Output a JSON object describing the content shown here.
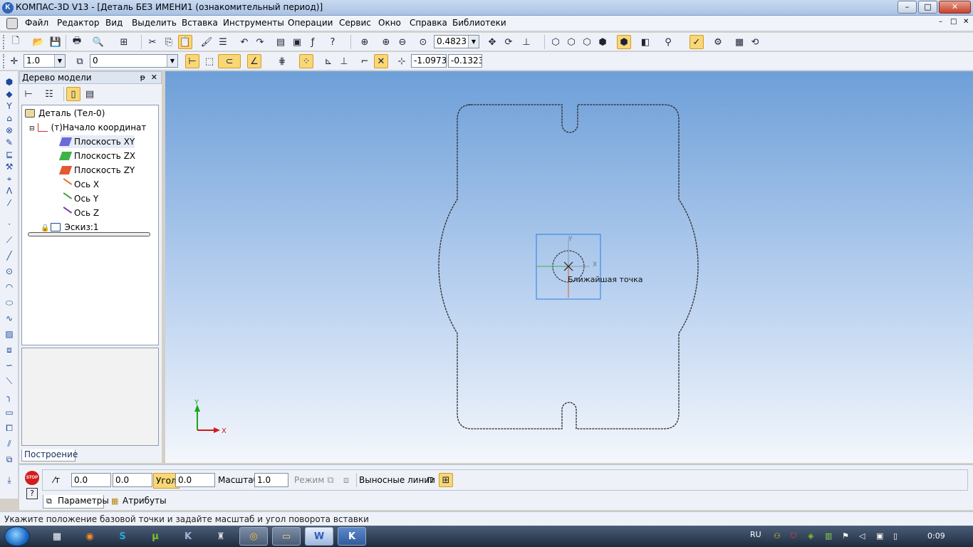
{
  "window": {
    "app_name": "КОМПАС-3D V13",
    "title_sep": " - ",
    "doc_title": "[Деталь БЕЗ ИМЕНИ1 (ознакомительный период)]",
    "min_label": "–",
    "max_label": "□",
    "close_label": "✕"
  },
  "menu": [
    "Файл",
    "Редактор",
    "Вид",
    "Выделить",
    "Вставка",
    "Инструменты",
    "Операции",
    "Сервис",
    "Окно",
    "Справка",
    "Библиотеки"
  ],
  "toolbar": {
    "zoom_value": "0.4823"
  },
  "toolbar2": {
    "line_scale": "1.0",
    "layer": "0",
    "coord_x": "-1.0973",
    "coord_y": "-0.1323"
  },
  "model_tree": {
    "header": "Дерево модели",
    "pin": "ᵽ",
    "close": "✕",
    "nodes": [
      {
        "label": "Деталь (Тел-0)",
        "icon": "part-icon"
      },
      {
        "label": "(т)Начало координат",
        "icon": "origin-icon"
      },
      {
        "label": "Плоскость XY",
        "icon": "plane-xy-icon"
      },
      {
        "label": "Плоскость ZX",
        "icon": "plane-zx-icon"
      },
      {
        "label": "Плоскость ZY",
        "icon": "plane-zy-icon"
      },
      {
        "label": "Ось X",
        "icon": "axis-x-icon"
      },
      {
        "label": "Ось Y",
        "icon": "axis-y-icon"
      },
      {
        "label": "Ось Z",
        "icon": "axis-z-icon"
      },
      {
        "label": "Эскиз:1",
        "icon": "sketch-icon"
      }
    ],
    "tab": "Построение"
  },
  "canvas": {
    "snap_hint": "Ближайшая точка",
    "axis_x": "X",
    "axis_y": "Y",
    "origin_axis_x": "X",
    "origin_axis_y": "Y"
  },
  "propbar": {
    "point_label": "т",
    "x": "0.0",
    "y": "0.0",
    "angle_label": "Угол",
    "angle": "0.0",
    "scale_label": "Масштаб",
    "scale": "1.0",
    "mode_label": "Режим",
    "lines_label": "Выносные линии",
    "tab_params": "Параметры",
    "tab_attrs": "Атрибуты",
    "stop": "STOP"
  },
  "status": {
    "hint": "Укажите положение базовой точки и задайте масштаб и угол поворота вставки"
  },
  "taskbar": {
    "lang": "RU",
    "time": "0:09"
  },
  "colors": {
    "canvas_top": "#6d9fd8",
    "canvas_bottom": "#f4f7fc",
    "active_button": "#f8d776",
    "selection_box": "#2a7de0"
  }
}
